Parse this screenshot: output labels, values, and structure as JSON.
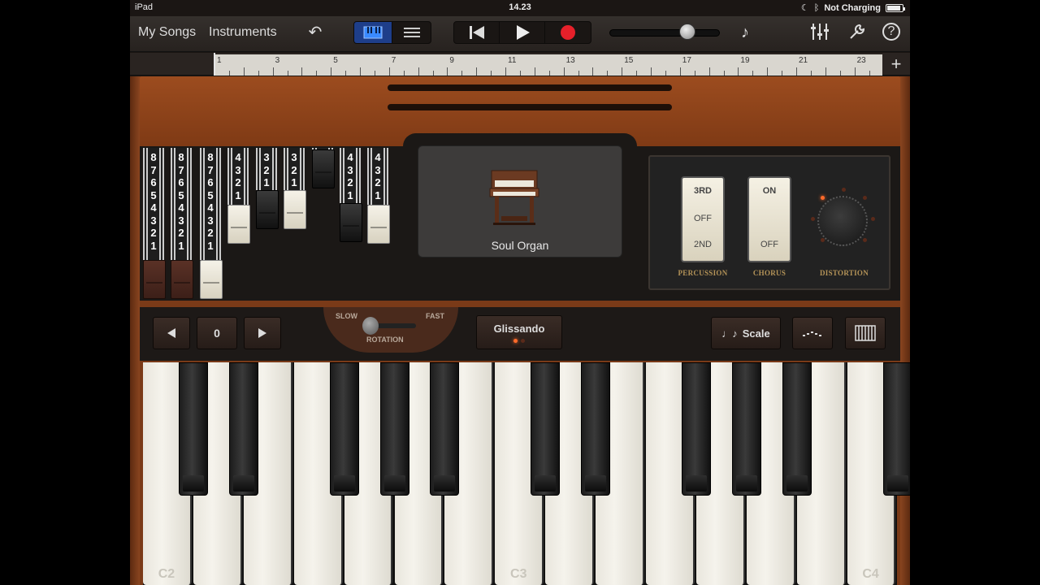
{
  "status": {
    "device": "iPad",
    "time": "14.23",
    "battery_text": "Not Charging"
  },
  "toolbar": {
    "my_songs": "My Songs",
    "instruments": "Instruments",
    "undo_icon": "undo-icon",
    "view_keyboard_icon": "keyboard-view-icon",
    "view_tracks_icon": "tracks-view-icon",
    "rewind_icon": "rewind-icon",
    "play_icon": "play-icon",
    "record_icon": "record-icon",
    "volume_level": 0.7,
    "metronome_icon": "metronome-icon",
    "mixer_icon": "mixer-icon",
    "settings_icon": "wrench-icon",
    "help_icon": "help-icon"
  },
  "ruler": {
    "labels": [
      "1",
      "3",
      "5",
      "7",
      "9",
      "11",
      "13",
      "15",
      "17",
      "19",
      "21",
      "23"
    ],
    "add_label": "+"
  },
  "drawbars": [
    {
      "nums": [
        "8",
        "7",
        "6",
        "5",
        "4",
        "3",
        "2",
        "1"
      ],
      "color": "brown"
    },
    {
      "nums": [
        "8",
        "7",
        "6",
        "5",
        "4",
        "3",
        "2",
        "1"
      ],
      "color": "brown"
    },
    {
      "nums": [
        "8",
        "7",
        "6",
        "5",
        "4",
        "3",
        "2",
        "1"
      ],
      "color": "white"
    },
    {
      "nums": [
        "4",
        "3",
        "2",
        "1"
      ],
      "color": "white"
    },
    {
      "nums": [
        "3",
        "2",
        "1"
      ],
      "color": "black"
    },
    {
      "nums": [
        "3",
        "2",
        "1"
      ],
      "color": "white"
    },
    {
      "nums": [],
      "color": "black"
    },
    {
      "nums": [
        "4",
        "3",
        "2",
        "1"
      ],
      "color": "black"
    },
    {
      "nums": [
        "4",
        "3",
        "2",
        "1"
      ],
      "color": "white"
    }
  ],
  "instrument": {
    "name": "Soul Organ",
    "icon": "organ-icon"
  },
  "switches": {
    "percussion": {
      "top": "3RD",
      "middle": "OFF",
      "bottom": "2ND",
      "label": "PERCUSSION"
    },
    "chorus": {
      "top": "ON",
      "bottom": "OFF",
      "label": "CHORUS"
    },
    "distortion": {
      "label": "DISTORTION"
    }
  },
  "controls": {
    "octave_value": "0",
    "rotation_slow": "SLOW",
    "rotation_fast": "FAST",
    "rotation_label": "ROTATION",
    "glissando": "Glissando",
    "scale": "Scale"
  },
  "keyboard": {
    "labels": {
      "c2": "C2",
      "c3": "C3",
      "c4": "C4"
    }
  }
}
